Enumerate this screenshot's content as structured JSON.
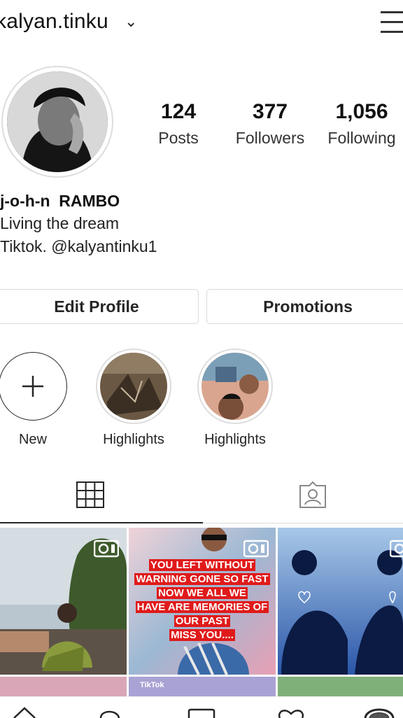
{
  "header": {
    "username": "kalyan.tinku",
    "caret": "⌄"
  },
  "stats": [
    {
      "number": "124",
      "label": "Posts"
    },
    {
      "number": "377",
      "label": "Followers"
    },
    {
      "number": "1,056",
      "label": "Following"
    }
  ],
  "bio": {
    "name": "j-o-h-n  RAMBO",
    "line1": "Living the dream",
    "line2": "Tiktok. @kalyantinku1"
  },
  "buttons": {
    "edit_profile": "Edit Profile",
    "promotions": "Promotions"
  },
  "highlights": [
    {
      "label": "New"
    },
    {
      "label": "Highlights"
    },
    {
      "label": "Highlights"
    }
  ],
  "tabs": {
    "grid_icon": "grid-icon",
    "tagged_icon": "tagged-icon"
  },
  "posts": {
    "overlay_text": [
      "YOU LEFT WITHOUT",
      "WARNING GONE SO FAST",
      "NOW WE ALL WE",
      "HAVE ARE MEMORIES OF",
      "OUR PAST",
      "MISS YOU...."
    ],
    "watermark": "TikTok"
  },
  "colors": {
    "text": "#262626",
    "border": "#dbdbdb",
    "overlay_red": "#e01a1a"
  }
}
